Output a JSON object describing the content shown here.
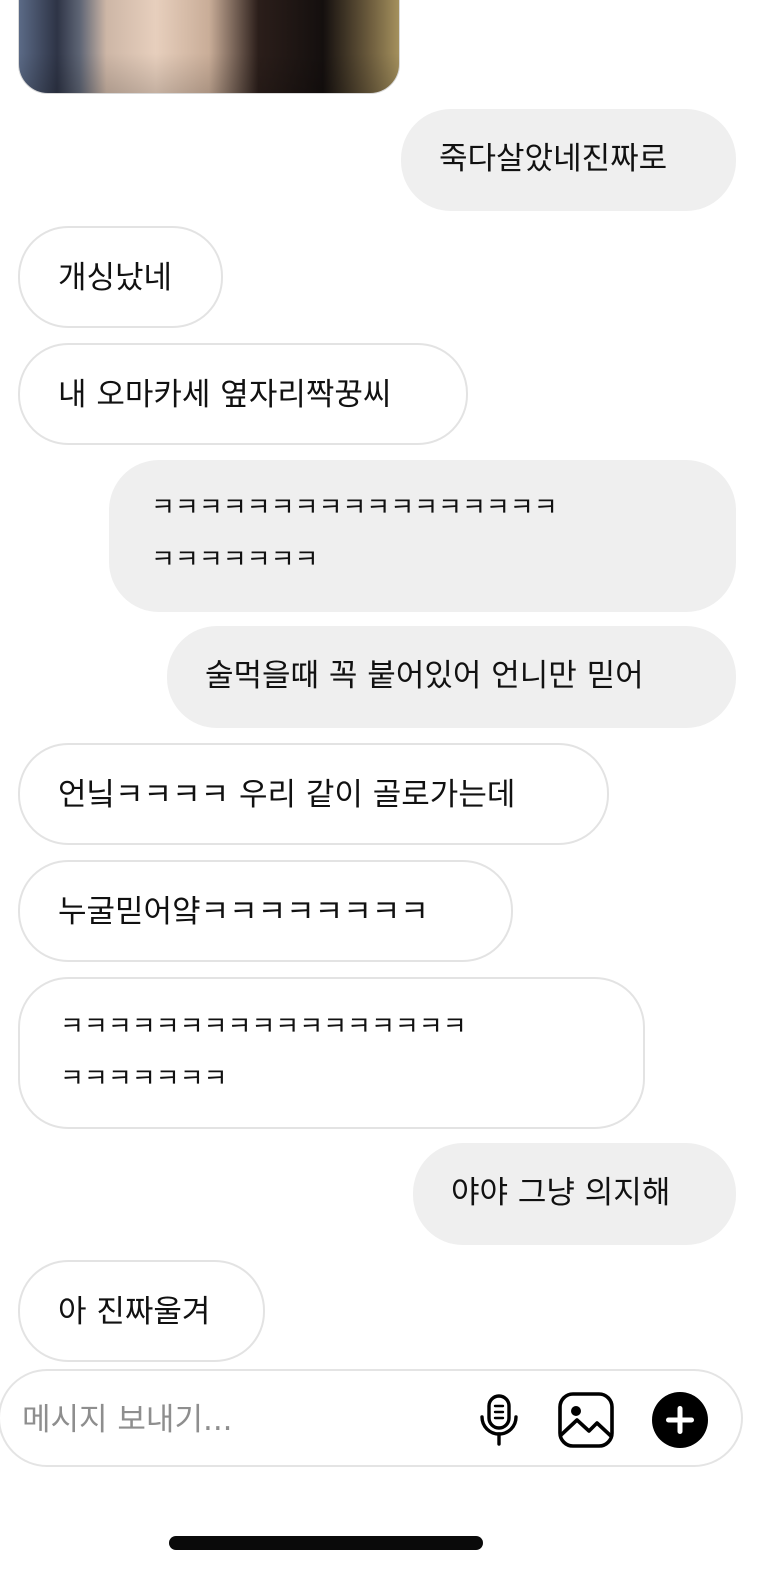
{
  "colors": {
    "outgoing_bubble": "#efefef",
    "incoming_border": "#e3e3e3",
    "placeholder": "#8e8e8e",
    "icon": "#000000"
  },
  "messages": [
    {
      "direction": "out",
      "text": "죽다살았네진짜로"
    },
    {
      "direction": "in",
      "text": "개싱났네"
    },
    {
      "direction": "in",
      "text": "내 오마카세 옆자리짝꿍씨"
    },
    {
      "direction": "out",
      "text": "ㅋㅋㅋㅋㅋㅋㅋㅋㅋㅋㅋㅋㅋㅋㅋㅋㅋ\nㅋㅋㅋㅋㅋㅋㅋ"
    },
    {
      "direction": "out",
      "text": "술먹을때 꼭 붙어있어 언니만 믿어"
    },
    {
      "direction": "in",
      "text": "언닠ㅋㅋㅋㅋ 우리 같이 골로가는데"
    },
    {
      "direction": "in",
      "text": "누굴믿어얔ㅋㅋㅋㅋㅋㅋㅋㅋ"
    },
    {
      "direction": "in",
      "text": "ㅋㅋㅋㅋㅋㅋㅋㅋㅋㅋㅋㅋㅋㅋㅋㅋㅋ\nㅋㅋㅋㅋㅋㅋㅋ"
    },
    {
      "direction": "out",
      "text": "야야 그냥 의지해"
    },
    {
      "direction": "in",
      "text": "아 진짜울겨"
    }
  ],
  "composer": {
    "placeholder": "메시지 보내기...",
    "icons": {
      "mic": "microphone-icon",
      "gallery": "image-gallery-icon",
      "plus": "add-circle-icon"
    }
  }
}
